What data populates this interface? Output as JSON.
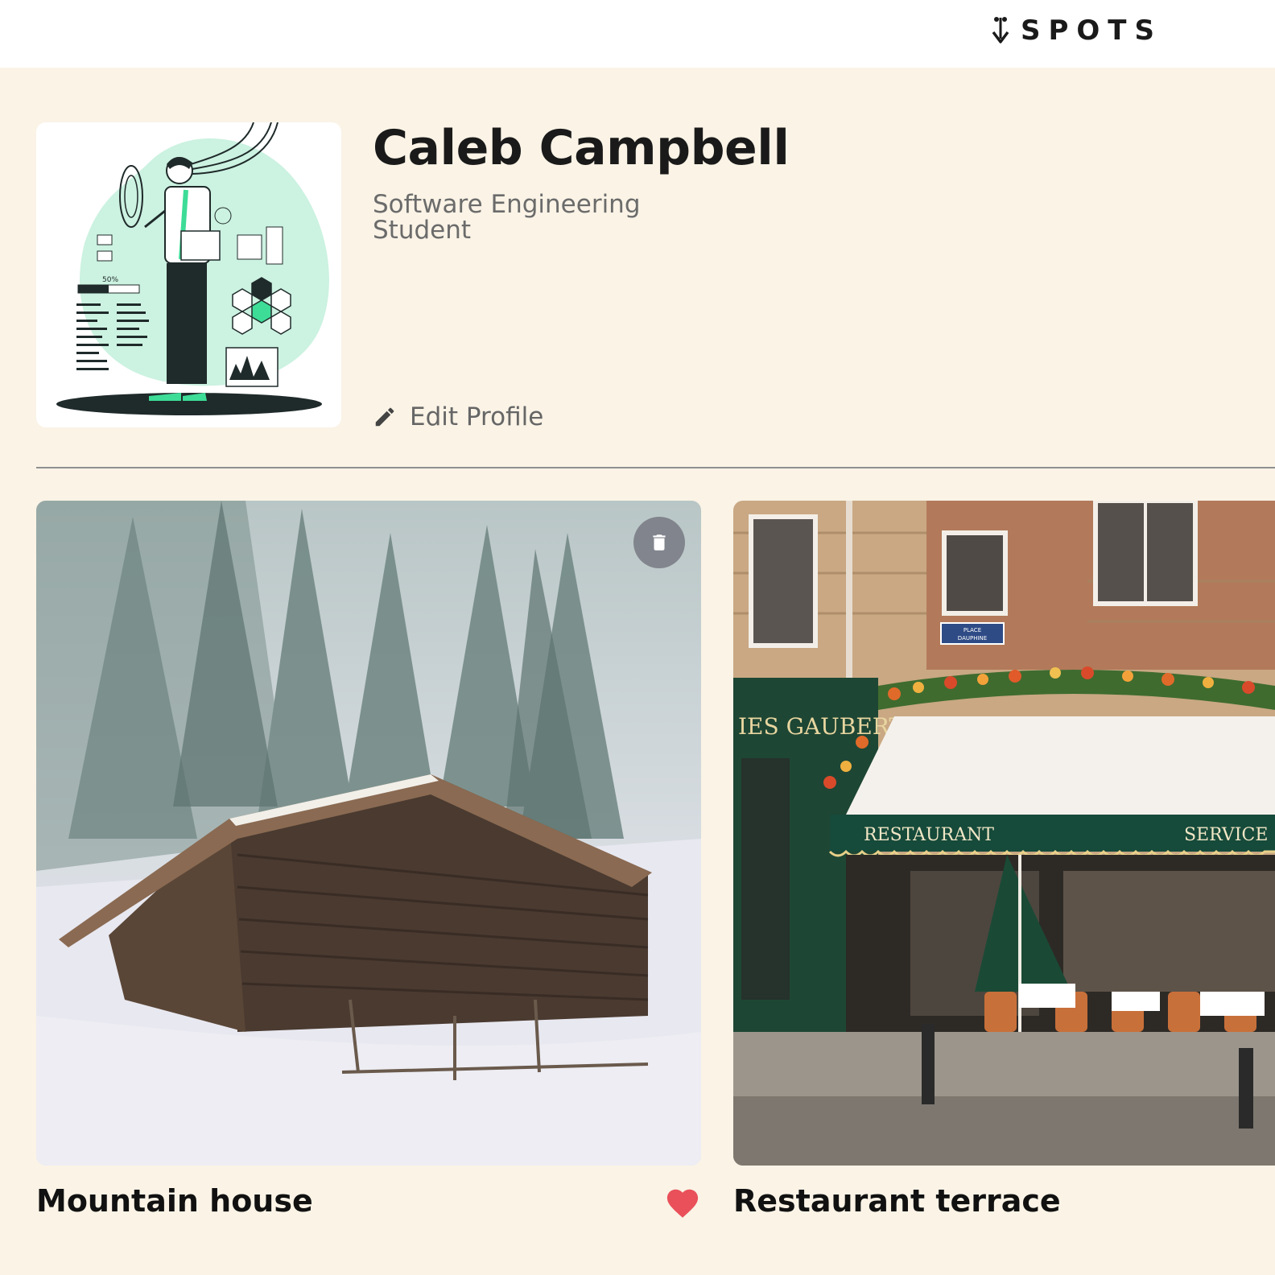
{
  "header": {
    "logo_text": "SPOTS"
  },
  "profile": {
    "name": "Caleb Campbell",
    "role": "Software Engineering Student",
    "edit_label": "Edit Profile",
    "avatar_progress_label": "50%"
  },
  "cards": [
    {
      "title": "Mountain house",
      "liked": true,
      "icon_like": "heart-icon",
      "icon_delete": "trash-icon"
    },
    {
      "title": "Restaurant terrace",
      "liked": false,
      "sign_text_1": "RESTAURANT",
      "sign_text_2": "SERVICE",
      "sign_text_3": "IES GAUBERT",
      "street_sign": "PLACE DAUPHINE"
    }
  ],
  "colors": {
    "page_bg": "#faf3e6",
    "header_bg": "#ffffff",
    "heart": "#e9505a",
    "accent_green": "#3ddc97"
  }
}
